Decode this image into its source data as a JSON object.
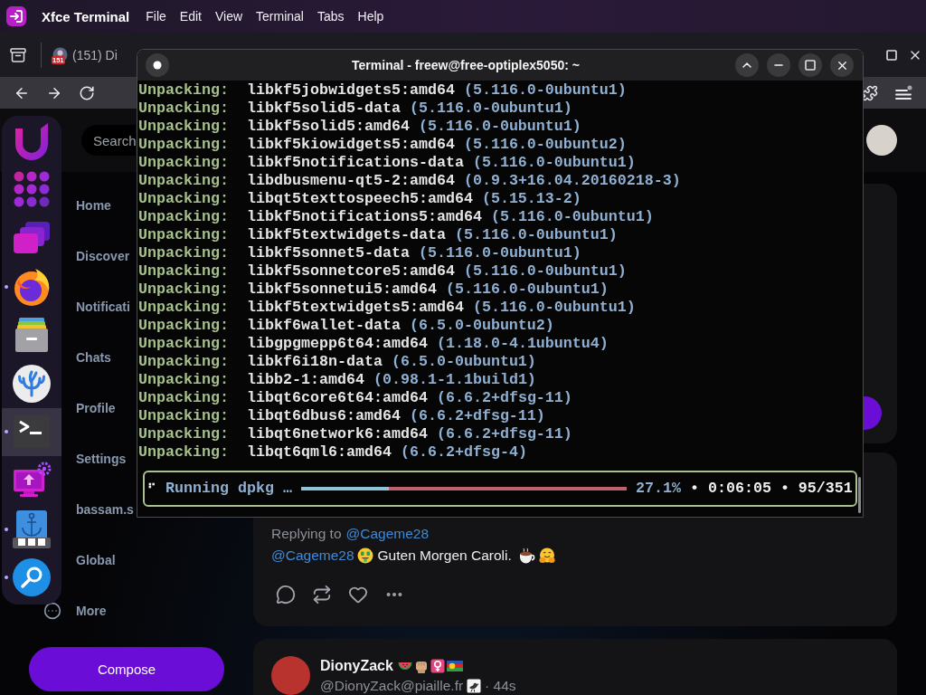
{
  "panel": {
    "title": "Xfce Terminal",
    "menus": [
      "File",
      "Edit",
      "View",
      "Terminal",
      "Tabs",
      "Help"
    ]
  },
  "browser": {
    "tab": {
      "badge": "151",
      "title": "(151) Di",
      "selected": false
    },
    "search": {
      "placeholder": "Search"
    },
    "nav": [
      {
        "label": "Home"
      },
      {
        "label": "Discover"
      },
      {
        "label": "Notificati"
      },
      {
        "label": "Chats"
      },
      {
        "label": "Profile"
      },
      {
        "label": "Settings"
      },
      {
        "label": "bassam.s"
      },
      {
        "label": "Global"
      },
      {
        "label": "More"
      }
    ],
    "compose": "Compose",
    "posts": [
      {
        "kind": "reply",
        "reply": {
          "prefix": "Replying to",
          "mention": "@Cageme28"
        },
        "mention": "@Cageme28",
        "text": "Guten Morgen Caroli."
      },
      {
        "kind": "author",
        "author": {
          "name": "DionyZack",
          "handle": "@DionyZack@piaille.fr",
          "time": "· 44s"
        }
      }
    ]
  },
  "dock": [
    {
      "running": false,
      "active": false
    },
    {
      "running": false,
      "active": false
    },
    {
      "running": false,
      "active": false
    },
    {
      "running": true,
      "active": false
    },
    {
      "running": false,
      "active": false
    },
    {
      "running": false,
      "active": false
    },
    {
      "running": true,
      "active": true
    },
    {
      "running": false,
      "active": false
    },
    {
      "running": true,
      "active": false
    },
    {
      "running": true,
      "active": false
    }
  ],
  "terminal": {
    "title": "Terminal - freew@free-optiplex5050: ~",
    "lines": [
      {
        "status": "Unpacking:",
        "package": "libkf5jobwidgets5:amd64",
        "version": "(5.116.0-0ubuntu1)"
      },
      {
        "status": "Unpacking:",
        "package": "libkf5solid5-data",
        "version": "(5.116.0-0ubuntu1)"
      },
      {
        "status": "Unpacking:",
        "package": "libkf5solid5:amd64",
        "version": "(5.116.0-0ubuntu1)"
      },
      {
        "status": "Unpacking:",
        "package": "libkf5kiowidgets5:amd64",
        "version": "(5.116.0-0ubuntu2)"
      },
      {
        "status": "Unpacking:",
        "package": "libkf5notifications-data",
        "version": "(5.116.0-0ubuntu1)"
      },
      {
        "status": "Unpacking:",
        "package": "libdbusmenu-qt5-2:amd64",
        "version": "(0.9.3+16.04.20160218-3)"
      },
      {
        "status": "Unpacking:",
        "package": "libqt5texttospeech5:amd64",
        "version": "(5.15.13-2)"
      },
      {
        "status": "Unpacking:",
        "package": "libkf5notifications5:amd64",
        "version": "(5.116.0-0ubuntu1)"
      },
      {
        "status": "Unpacking:",
        "package": "libkf5textwidgets-data",
        "version": "(5.116.0-0ubuntu1)"
      },
      {
        "status": "Unpacking:",
        "package": "libkf5sonnet5-data",
        "version": "(5.116.0-0ubuntu1)"
      },
      {
        "status": "Unpacking:",
        "package": "libkf5sonnetcore5:amd64",
        "version": "(5.116.0-0ubuntu1)"
      },
      {
        "status": "Unpacking:",
        "package": "libkf5sonnetui5:amd64",
        "version": "(5.116.0-0ubuntu1)"
      },
      {
        "status": "Unpacking:",
        "package": "libkf5textwidgets5:amd64",
        "version": "(5.116.0-0ubuntu1)"
      },
      {
        "status": "Unpacking:",
        "package": "libkf6wallet-data",
        "version": "(6.5.0-0ubuntu2)"
      },
      {
        "status": "Unpacking:",
        "package": "libgpgmepp6t64:amd64",
        "version": "(1.18.0-4.1ubuntu4)"
      },
      {
        "status": "Unpacking:",
        "package": "libkf6i18n-data",
        "version": "(6.5.0-0ubuntu1)"
      },
      {
        "status": "Unpacking:",
        "package": "libb2-1:amd64",
        "version": "(0.98.1-1.1build1)"
      },
      {
        "status": "Unpacking:",
        "package": "libqt6core6t64:amd64",
        "version": "(6.6.2+dfsg-11)"
      },
      {
        "status": "Unpacking:",
        "package": "libqt6dbus6:amd64",
        "version": "(6.6.2+dfsg-11)"
      },
      {
        "status": "Unpacking:",
        "package": "libqt6network6:amd64",
        "version": "(6.6.2+dfsg-11)"
      },
      {
        "status": "Unpacking:",
        "package": "libqt6qml6:amd64",
        "version": "(6.6.2+dfsg-4)"
      }
    ],
    "progress": {
      "spinner": "⠋",
      "label": "Running dpkg …",
      "level": 0.271,
      "percent": "27.1%",
      "details": "• 0:06:05 • 95/351"
    }
  }
}
